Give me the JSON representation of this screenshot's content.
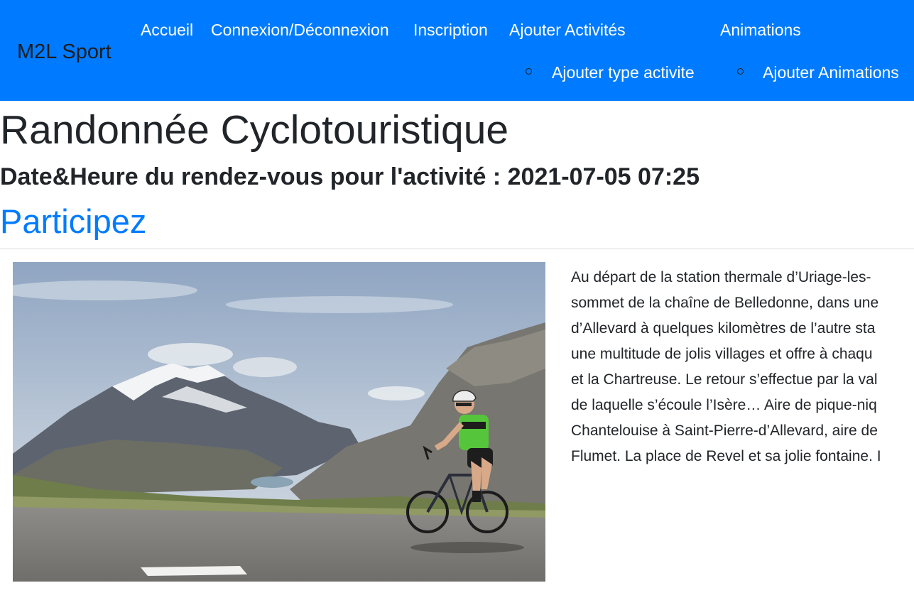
{
  "navbar": {
    "brand": "M2L Sport",
    "links": [
      "Accueil",
      "Connexion/Déconnexion",
      "Inscription",
      "Ajouter Activités",
      "Animations"
    ],
    "sub_items": [
      "Ajouter type activite",
      "Ajouter Animations"
    ],
    "background_color": "#007bff"
  },
  "activity": {
    "title": "Randonnée Cyclotouristique",
    "datetime_label": "Date&Heure du rendez-vous pour l'activité : 2021-07-05 07:25",
    "participate_label": "Participez",
    "description_lines": [
      "Au départ de la station thermale d’Uriage-les-",
      "sommet de la chaîne de Belledonne, dans une",
      "d’Allevard à quelques kilomètres de l’autre sta",
      "une multitude de jolis villages et offre à chaqu",
      "et la Chartreuse. Le retour s’effectue par la val",
      "de laquelle s’écoule l’Isère… Aire de pique-niq",
      "Chantelouise à Saint-Pierre-d’Allevard, aire de",
      "Flumet. La place de Revel et sa jolie fontaine. I"
    ]
  }
}
